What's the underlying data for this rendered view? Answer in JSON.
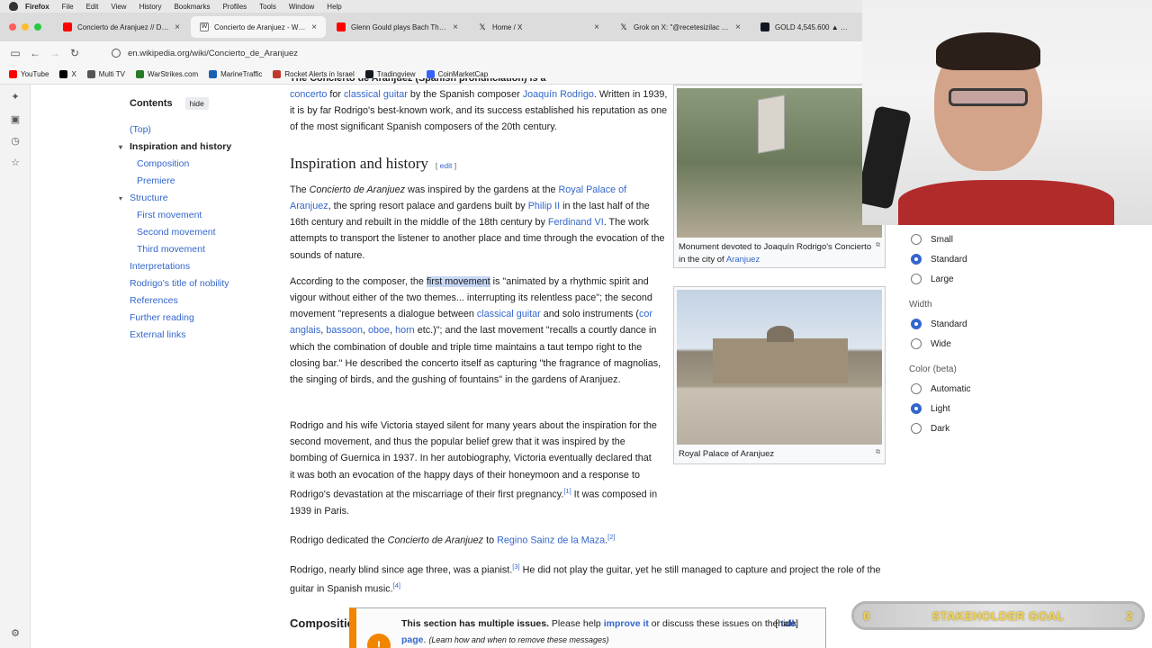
{
  "menubar": {
    "items": [
      "Firefox",
      "File",
      "Edit",
      "View",
      "History",
      "Bookmarks",
      "Profiles",
      "Tools",
      "Window",
      "Help"
    ]
  },
  "tabs": [
    {
      "title": "Concierto de Aranjuez // Danish",
      "favicon": "youtube-icon",
      "color": "#ff0000",
      "active": false
    },
    {
      "title": "Concierto de Aranjuez - Wikipe",
      "favicon": "wikipedia-icon",
      "color": "#777777",
      "active": true
    },
    {
      "title": "Glenn Gould plays Bach Three-",
      "favicon": "youtube-icon",
      "color": "#ff0000",
      "active": false
    },
    {
      "title": "Home / X",
      "favicon": "x-icon",
      "color": "#000000",
      "active": false
    },
    {
      "title": "Grok on X: \"@recetesizilac Sab",
      "favicon": "x-icon",
      "color": "#000000",
      "active": false
    },
    {
      "title": "GOLD 4,545.600 ▲ +1.1",
      "favicon": "tradingview-icon",
      "color": "#131722",
      "active": false
    }
  ],
  "url": "en.wikipedia.org/wiki/Concierto_de_Aranjuez",
  "bookmarks": [
    {
      "label": "YouTube",
      "color": "#ff0000"
    },
    {
      "label": "X",
      "color": "#000000"
    },
    {
      "label": "Multi TV",
      "color": "#555555"
    },
    {
      "label": "WarStrikes.com",
      "color": "#2a7a2a"
    },
    {
      "label": "MarineTraffic",
      "color": "#1a5fb4"
    },
    {
      "label": "Rocket Alerts in Israel",
      "color": "#c0392b"
    },
    {
      "label": "Tradingview",
      "color": "#131722"
    },
    {
      "label": "CoinMarketCap",
      "color": "#3861fb"
    }
  ],
  "toc": {
    "title": "Contents",
    "hide": "hide",
    "items": [
      "(Top)",
      "Inspiration and history",
      "Composition",
      "Premiere",
      "Structure",
      "First movement",
      "Second movement",
      "Third movement",
      "Interpretations",
      "Rodrigo's title of nobility",
      "References",
      "Further reading",
      "External links"
    ]
  },
  "article": {
    "intro_top": "The Concierto de Aranjuez (Spanish pronunciation) is a",
    "intro_p1": "concerto",
    "intro_p2": " for ",
    "intro_p3": "classical guitar",
    "intro_p4": " by the Spanish composer ",
    "intro_p5": "Joaquín Rodrigo",
    "intro_p6": ". Written in 1939, it is by far Rodrigo's best-known work, and its success established his reputation as one of the most significant Spanish composers of the 20th century.",
    "h_inspiration": "Inspiration and history",
    "edit": "edit",
    "p1_a": "The ",
    "p1_b": "Concierto de Aranjuez",
    "p1_c": " was inspired by the gardens at the ",
    "p1_d": "Royal Palace of Aranjuez",
    "p1_e": ", the spring resort palace and gardens built by ",
    "p1_f": "Philip II",
    "p1_g": " in the last half of the 16th century and rebuilt in the middle of the 18th century by ",
    "p1_h": "Ferdinand VI",
    "p1_i": ". The work attempts to transport the listener to another place and time through the evocation of the sounds of nature.",
    "p2_a": "According to the composer, the ",
    "p2_b": "first movement",
    "p2_c": " is \"animated by a rhythmic spirit and vigour without either of the two themes... interrupting its relentless pace\"; the second movement \"represents a dialogue between ",
    "p2_d": "classical guitar",
    "p2_e": " and solo instruments (",
    "p2_f": "cor anglais",
    "p2_g": ", ",
    "p2_h": "bassoon",
    "p2_i": ", ",
    "p2_j": "oboe",
    "p2_k": ", ",
    "p2_l": "horn",
    "p2_m": " etc.)\"; and the last movement \"recalls a courtly dance in which the combination of double and triple time maintains a taut tempo right to the closing bar.\" He described the concerto itself as capturing \"the fragrance of magnolias, the singing of birds, and the gushing of fountains\" in the gardens of Aranjuez.",
    "p3_a": "Rodrigo and his wife Victoria stayed silent for many years about the inspiration for the second movement, and thus the popular belief grew that it was inspired by the ",
    "p3_b": "bombing of Guernica",
    "p3_c": " in 1937. In her autobiography, Victoria eventually declared that it was both an evocation of the happy days of their honeymoon and a response to Rodrigo's devastation at the miscarriage of their first pregnancy.",
    "p3_ref": "[1]",
    "p3_d": " It was composed in 1939 in Paris.",
    "p4_a": "Rodrigo dedicated the ",
    "p4_b": "Concierto de Aranjuez",
    "p4_c": " to ",
    "p4_d": "Regino Sainz de la Maza",
    "p4_e": ".",
    "p4_ref": "[2]",
    "p5_a": "Rodrigo, nearly blind since age three, was a pianist.",
    "p5_ref": "[3]",
    "p5_b": " He did not play the guitar, yet he still managed to capture and project the role of the guitar in Spanish music.",
    "p5_ref2": "[4]",
    "h_composition": "Composition"
  },
  "figures": {
    "monument_caption_a": "Monument devoted to Joaquín Rodrigo's Concierto in the city of ",
    "monument_caption_b": "Aranjuez",
    "palace_caption": "Royal Palace of Aranjuez"
  },
  "appearance": {
    "text_options": [
      "Small",
      "Standard",
      "Large"
    ],
    "text_selected": "Standard",
    "width_label": "Width",
    "width_options": [
      "Standard",
      "Wide"
    ],
    "width_selected": "Standard",
    "color_label": "Color (beta)",
    "color_options": [
      "Automatic",
      "Light",
      "Dark"
    ],
    "color_selected": "Light"
  },
  "ambox": {
    "bold": "This section has multiple issues.",
    "text1": " Please help ",
    "link1": "improve it",
    "text2": " or discuss these issues on the ",
    "link2": "talk page",
    "text3": ". ",
    "italic": "(Learn how and when to remove these messages)",
    "hide": "[hide]"
  },
  "overlay": {
    "goal_left": "0",
    "goal_label": "STAKEHOLDER GOAL",
    "goal_right": "2"
  }
}
